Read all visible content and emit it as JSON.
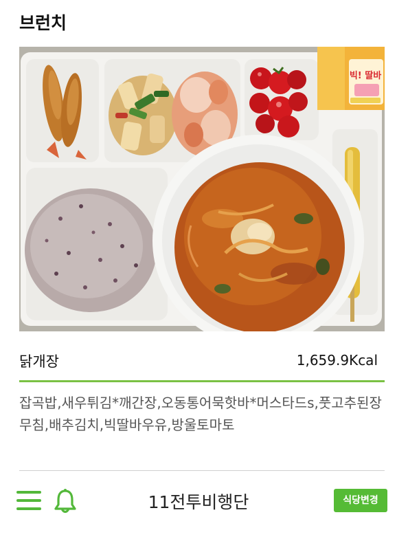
{
  "header": {
    "title": "브런치"
  },
  "meal": {
    "main_dish": "닭개장",
    "calories": "1,659.9Kcal",
    "menu_items": "잡곡밥,새우튀김*깨간장,오동통어묵핫바*머스타드s,풋고추된장무침,배추김치,빅딸바우유,방울토마토",
    "photo": {
      "milk_carton_text": "빅! 딸바"
    }
  },
  "footer": {
    "unit_name": "11전투비행단",
    "change_button_label": "식당변경"
  },
  "colors": {
    "accent_green": "#7ac143",
    "button_green": "#55bb35",
    "icon_green": "#53b83a"
  },
  "icons": [
    "hamburger-menu-icon",
    "bell-icon"
  ]
}
